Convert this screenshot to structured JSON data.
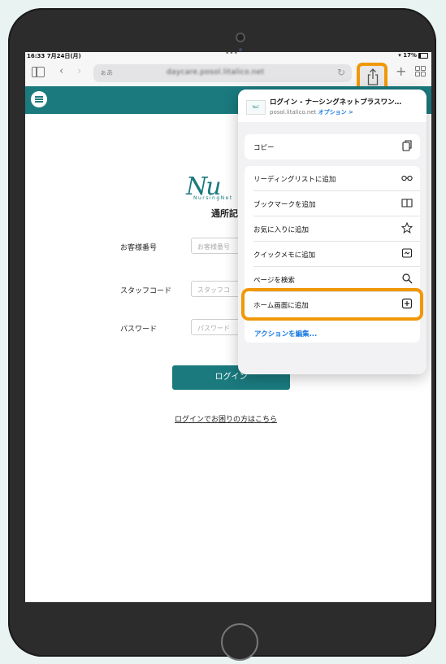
{
  "status": {
    "time": "16:33  7月24日(月)",
    "dots": "•••",
    "battery": "17%"
  },
  "toolbar": {
    "text_size": "ぁあ",
    "url": "daycare.posol.litalico.net"
  },
  "form": {
    "logo_text": "Nu",
    "logo_sub": "NursingNet",
    "title": "通所記",
    "customer_label": "お客様番号",
    "customer_placeholder": "お客様番号",
    "staff_label": "スタッフコード",
    "staff_placeholder": "スタッフコ",
    "password_label": "パスワード",
    "password_placeholder": "パスワード",
    "login_button": "ログイン",
    "help_link": "ログインでお困りの方はこちら"
  },
  "share_sheet": {
    "page_title": "ログイン - ナーシングネットプラスワン…",
    "page_host": "posol.litalico.net",
    "options_link": "オプション >",
    "copy": "コピー",
    "items": [
      "リーディングリストに追加",
      "ブックマークを追加",
      "お気に入りに追加",
      "クイックメモに追加",
      "ページを検索",
      "ホーム画面に追加"
    ],
    "edit_actions": "アクションを編集..."
  },
  "colors": {
    "brand_teal": "#1a7a7e",
    "highlight_orange": "#f0980a",
    "link_blue": "#1a7ae0"
  },
  "icons": [
    "sidebar-icon",
    "back-icon",
    "forward-icon",
    "reload-icon",
    "share-icon",
    "new-tab-icon",
    "tabs-overview-icon",
    "menu-icon",
    "copy-icon",
    "glasses-icon",
    "book-icon",
    "star-icon",
    "quick-note-icon",
    "search-icon",
    "add-square-icon"
  ]
}
